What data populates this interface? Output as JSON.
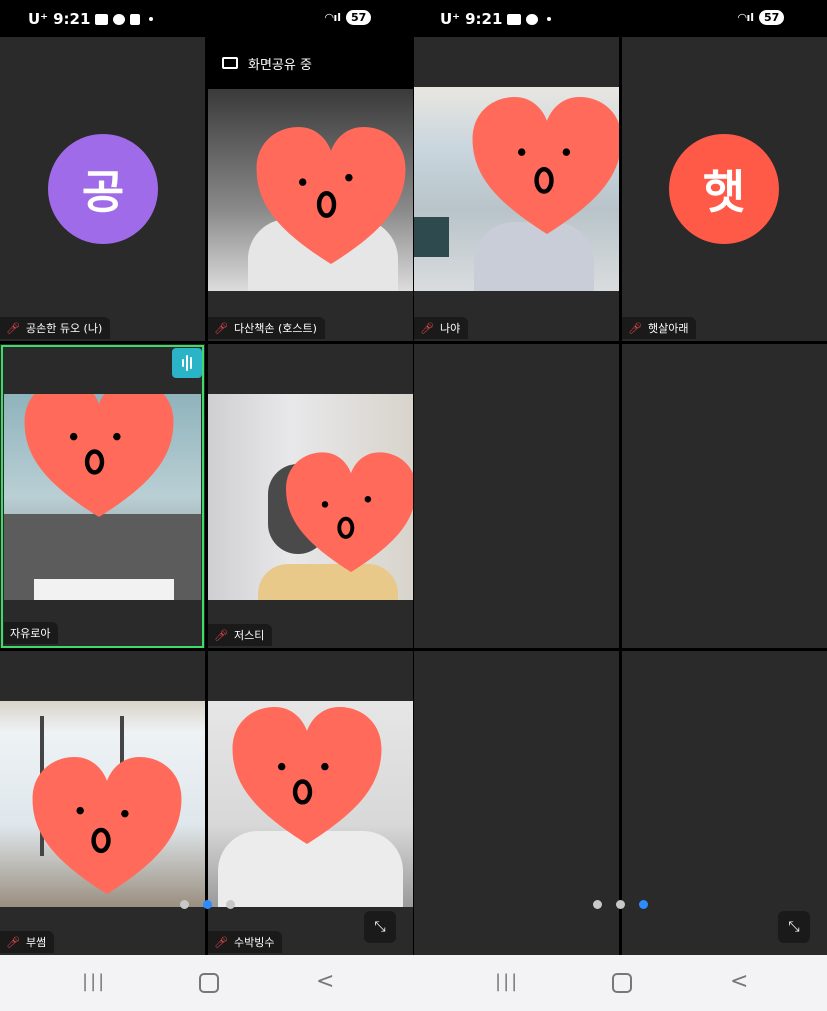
{
  "status_left": {
    "carrier": "U⁺",
    "time": "9:21",
    "battery": "57"
  },
  "status_right": {
    "carrier": "U⁺",
    "time": "9:21",
    "battery": "57"
  },
  "screen_share_banner": "화면공유 중",
  "participants": [
    {
      "name": "공손한 듀오 (나)",
      "avatar_letter": "공",
      "avatar_color": "#a06be8"
    },
    {
      "name": "다산책손 (호스트)"
    },
    {
      "name": "나야"
    },
    {
      "name": "햇살아래",
      "avatar_letter": "햇",
      "avatar_color": "#ff5a47"
    },
    {
      "name": "자유로아",
      "speaking": true
    },
    {
      "name": "저스티"
    },
    {
      "name": "부썸"
    },
    {
      "name": "수박빙수"
    }
  ],
  "pagination_left": {
    "pages": 3,
    "active": 2
  },
  "pagination_right": {
    "pages": 3,
    "active": 3
  },
  "colors": {
    "speaker_border": "#3ddc68",
    "speaker_badge": "#2bb4c8",
    "active_dot": "#2d8cff",
    "heart": "#ff6a5a"
  },
  "icons": {
    "mic_off": "mic-off-icon",
    "minimize": "minimize-icon",
    "share": "screen-share-icon"
  }
}
